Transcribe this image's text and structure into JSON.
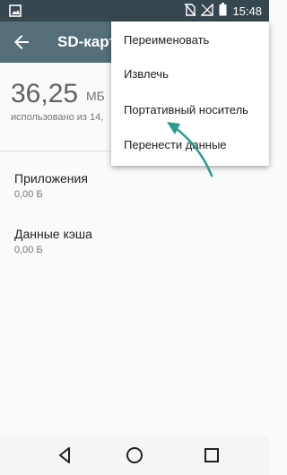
{
  "status_bar": {
    "time": "15:48",
    "icons": [
      "image-icon",
      "no-sim-icon",
      "signal-icon",
      "battery-icon"
    ]
  },
  "toolbar": {
    "title": "SD-карта",
    "back_icon": "arrow-left-icon"
  },
  "storage": {
    "used_value": "36,25",
    "used_unit": "МБ",
    "used_description": "использовано из 14,"
  },
  "items": [
    {
      "title": "Приложения",
      "size": "0,00 Б"
    },
    {
      "title": "Данные кэша",
      "size": "0,00 Б"
    }
  ],
  "overflow_menu": {
    "items": [
      {
        "label": "Переименовать"
      },
      {
        "label": "Извлечь"
      },
      {
        "label": "Портативный носитель"
      },
      {
        "label": "Перенести данные"
      }
    ]
  },
  "nav_bar": {
    "icons": [
      "back-triangle-icon",
      "home-circle-icon",
      "recents-square-icon"
    ]
  },
  "annotation": {
    "arrow_color": "#2a9d8f"
  }
}
